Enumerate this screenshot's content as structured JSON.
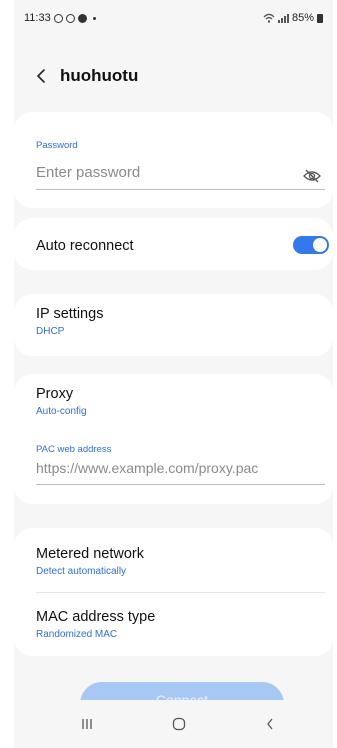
{
  "status_bar": {
    "time": "11:33",
    "battery": "85%"
  },
  "header": {
    "title": "huohuotu"
  },
  "password": {
    "label": "Password",
    "placeholder": "Enter password"
  },
  "auto_reconnect": {
    "label": "Auto reconnect",
    "enabled": true
  },
  "ip_settings": {
    "label": "IP settings",
    "value": "DHCP"
  },
  "proxy": {
    "label": "Proxy",
    "value": "Auto-config",
    "pac_label": "PAC web address",
    "pac_placeholder": "https://www.example.com/proxy.pac"
  },
  "metered": {
    "label": "Metered network",
    "value": "Detect automatically"
  },
  "mac": {
    "label": "MAC address type",
    "value": "Randomized MAC"
  },
  "connect_label": "Connect",
  "colors": {
    "accent": "#3578ea",
    "link_text": "#2f6fd6",
    "background": "#f6f6f6"
  }
}
